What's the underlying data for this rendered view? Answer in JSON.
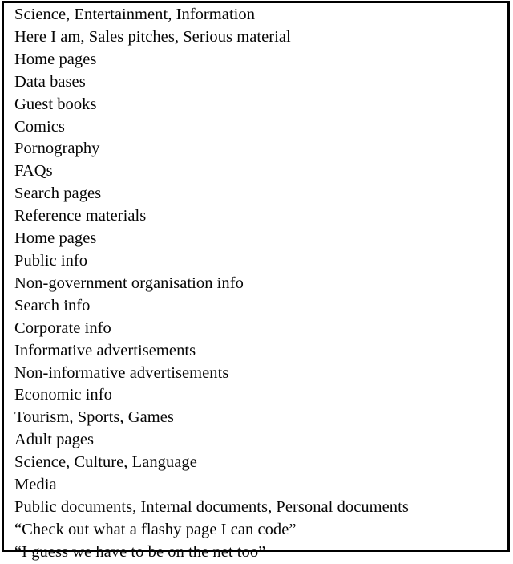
{
  "document": {
    "kind": "bordered-text-table",
    "colors": {
      "border": "#000000",
      "background": "#ffffff",
      "text": "#060606"
    },
    "rows": [
      "Science, Entertainment, Information",
      "Here I am, Sales pitches, Serious material",
      "Home pages",
      "Data bases",
      "Guest books",
      "Comics",
      "Pornography",
      "FAQs",
      "Search pages",
      "Reference materials",
      "Home pages",
      "Public info",
      "Non-government organisation info",
      "Search info",
      "Corporate info",
      "Informative advertisements",
      "Non-informative advertisements",
      "Economic info",
      "Tourism, Sports, Games",
      "Adult pages",
      "Science, Culture, Language",
      "Media",
      "Public documents, Internal documents, Personal documents",
      "“Check out what a flashy page I can code”",
      "“I guess we have to be on the net too”"
    ]
  }
}
